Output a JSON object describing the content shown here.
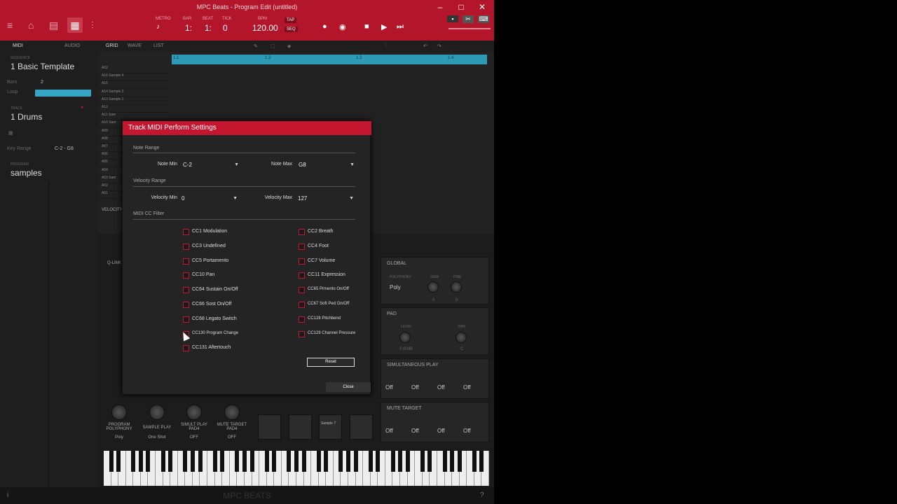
{
  "window": {
    "title": "MPC Beats - Program Edit (untitled)"
  },
  "transport": {
    "metro_label": "METRO",
    "bar_label": "BAR",
    "beat_label": "BEAT",
    "tick_label": "TICK",
    "bpm_label": "BPM",
    "bar": "1:",
    "beat": "1:",
    "tick": "0",
    "bpm": "120.00",
    "tap_label": "TAP",
    "seq_label": "SEQ"
  },
  "tabs": {
    "midi": "MIDI",
    "audio": "AUDIO",
    "grid": "GRID",
    "wave": "WAVE",
    "list": "LIST"
  },
  "left": {
    "sequence_label": "SEQUENCE",
    "sequence_name": "1 Basic Template",
    "bars_label": "Bars",
    "bars_value": "2",
    "loop_label": "Loop",
    "track_label": "TRACK",
    "track_name": "1 Drums",
    "key_range_label": "Key Range",
    "key_range_value": "C-2 - G8",
    "program_label": "PROGRAM",
    "program_name": "samples"
  },
  "ruler": {
    "marks": [
      "1.1",
      "1.2",
      "1.3",
      "1.4"
    ]
  },
  "pad_rows": [
    "A02",
    "A16 Sample 4",
    "A15",
    "A14 Sample 2",
    "A13 Sample 1",
    "A12",
    "A11 Sam",
    "A10 Sam",
    "A09",
    "A08",
    "A07",
    "A06",
    "A05",
    "A04",
    "A03 Sam",
    "A02",
    "A01"
  ],
  "lower": {
    "velocity_label": "VELOCITY",
    "qlink_label": "Q-LINK",
    "global_label": "GLOBAL",
    "polyphony_label": "POLYPHONY",
    "semi_label": "SEMI",
    "fine_label": "FINE",
    "poly_value": "Poly",
    "semi_value": "0",
    "fine_value": "0",
    "pad_label": "PAD",
    "level_label": "LEVEL",
    "pan_label": "PAN",
    "level_value": "0.00dB",
    "pan_value": "C",
    "simul_label": "SIMULTANEOUS PLAY",
    "mute_label": "MUTE TARGET",
    "off": "Off",
    "knobs": [
      {
        "label": "PROGRAM POLYPHONY",
        "value": "Poly"
      },
      {
        "label": "SAMPLE PLAY",
        "value": "One Shot"
      },
      {
        "label": "SIMULT PLAY PAD4",
        "value": "OFF"
      },
      {
        "label": "MUTE TARGET PAD4",
        "value": "OFF"
      }
    ],
    "pad_sample": "Sample 7"
  },
  "footer": {
    "logo": "MPC BEATS"
  },
  "dialog": {
    "title": "Track MIDI Perform Settings",
    "note_range": "Note Range",
    "note_min_label": "Note Min",
    "note_min_value": "C-2",
    "note_max_label": "Note Max",
    "note_max_value": "G8",
    "velocity_range": "Velocity Range",
    "vel_min_label": "Velocity Min",
    "vel_min_value": "0",
    "vel_max_label": "Velocity Max",
    "vel_max_value": "127",
    "cc_filter": "MIDI CC Filter",
    "cc_left": [
      "CC1 Modulation",
      "CC3 Undefined",
      "CC5 Portamento",
      "CC10 Pan",
      "CC64 Sustain On/Off",
      "CC66 Sost On/Off",
      "CC68 Legato Switch",
      "CC130 Program Change",
      "CC131 Aftertouch"
    ],
    "cc_right": [
      "CC2 Breath",
      "CC4 Foot",
      "CC7 Volume",
      "CC11 Expression",
      "CC65 Prmento On/Off",
      "CC67 Soft Ped On/Off",
      "CC128 Pitchbend",
      "CC129 Channel Pressure"
    ],
    "reset": "Reset",
    "close": "Close"
  }
}
